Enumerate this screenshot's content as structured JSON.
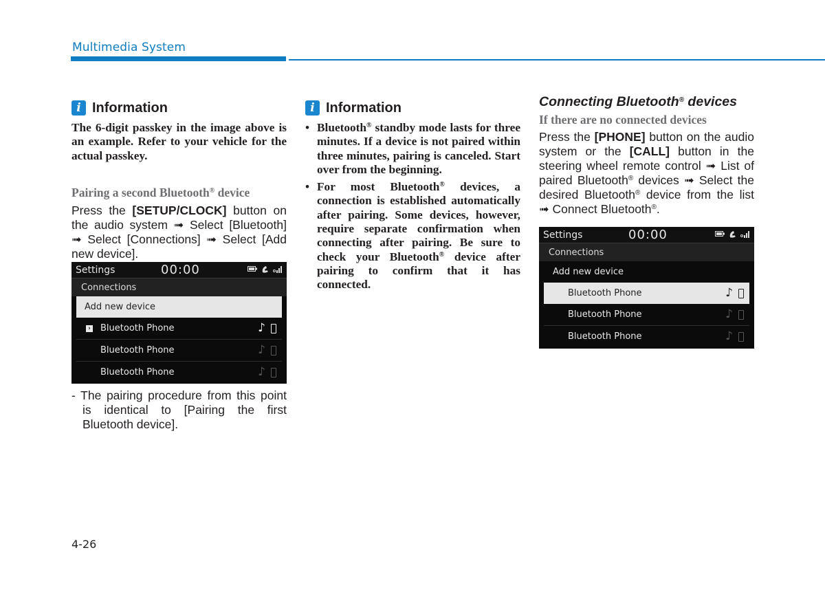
{
  "header": {
    "section_title": "Multimedia System"
  },
  "column1": {
    "info_title": "Information",
    "info_text": "The 6-digit passkey in the image above is an example. Refer to your vehicle for the actual passkey.",
    "subheading_pre": "Pairing a second Bluetooth",
    "subheading_sup": "®",
    "subheading_post": " device",
    "body": {
      "t1": "Press the ",
      "b1": "[SETUP/CLOCK]",
      "t2": " button on the audio system ➟ Select [Bluetooth] ➟ Select [Connections] ➟ Select [Add new device]."
    },
    "screen": {
      "title": "Settings",
      "clock": "00:00",
      "status_icons": [
        "battery-icon",
        "phone-call-icon",
        "signal-icon"
      ],
      "subtitle": "Connections",
      "add_label": "Add new device",
      "rows": [
        {
          "label": "Bluetooth Phone",
          "active": true,
          "chevron": "›"
        },
        {
          "label": "Bluetooth Phone",
          "active": false
        },
        {
          "label": "Bluetooth Phone",
          "active": false
        }
      ],
      "music_glyph": "♪"
    },
    "note": "- The pairing procedure from this point is identical to [Pairing the first Bluetooth device]."
  },
  "column2": {
    "info_title": "Information",
    "bullets": [
      {
        "pre": "Bluetooth",
        "sup": "®",
        "post": " standby mode lasts for three minutes. If a device is not paired within three minutes, pairing is canceled. Start over from the beginning."
      },
      {
        "pre": "For most Bluetooth",
        "sup": "®",
        "post": " devices, a connection is established automatically after pairing. Some devices, however, require separate confirmation when connecting after pairing. Be sure to check your Bluetooth",
        "sup2": "®",
        "post2": " device after pairing to confirm that it has connected."
      }
    ]
  },
  "column3": {
    "section_title_pre": "Connecting Bluetooth",
    "section_title_sup": "®",
    "section_title_post": " devices",
    "subheading": "If there are no connected devices",
    "body": {
      "t1": "Press the ",
      "b1": "[PHONE]",
      "t2": " button on the audio system or the ",
      "b2": "[CALL]",
      "t3": " button in the steering wheel remote control ➟ List of paired Bluetooth",
      "s1": "®",
      "t4": " devices ➟ Select the desired Bluetooth",
      "s2": "®",
      "t5": " device from the list ➟ Connect Bluetooth",
      "s3": "®",
      "t6": "."
    },
    "screen": {
      "title": "Settings",
      "clock": "00:00",
      "subtitle": "Connections",
      "add_label": "Add new device",
      "rows": [
        {
          "label": "Bluetooth Phone",
          "selected": true
        },
        {
          "label": "Bluetooth Phone",
          "selected": false
        },
        {
          "label": "Bluetooth Phone",
          "selected": false
        }
      ],
      "music_glyph": "♪"
    }
  },
  "footer": {
    "page_number": "4-26"
  },
  "colors": {
    "accent": "#0f7dc2",
    "info_icon": "#1a86cf",
    "subheading_gray": "#6d6e71"
  }
}
